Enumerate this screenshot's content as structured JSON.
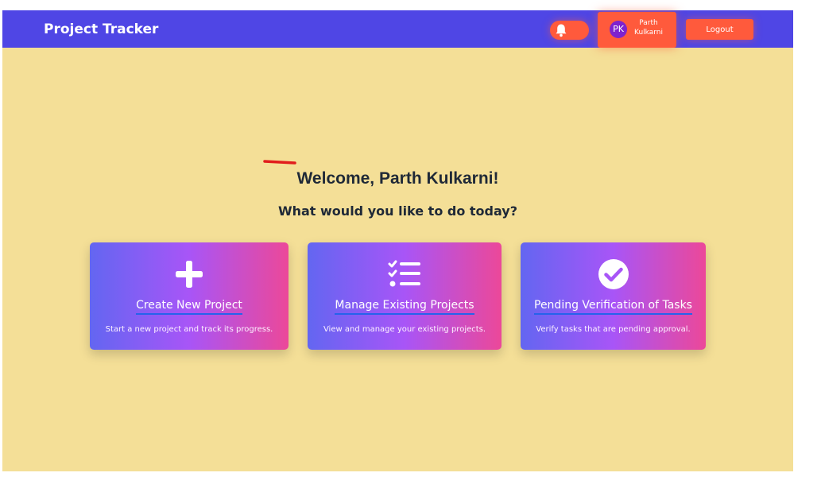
{
  "navbar": {
    "brand": "Project Tracker",
    "bell_icon": "bell-icon",
    "user": {
      "initials": "PK",
      "first_name": "Parth",
      "last_name": "Kulkarni"
    },
    "logout_label": "Logout"
  },
  "main": {
    "welcome": "Welcome, Parth Kulkarni!",
    "subtitle": "What would you like to do today?",
    "cards": [
      {
        "icon": "plus-icon",
        "title": "Create New Project",
        "description": "Start a new project and track its progress."
      },
      {
        "icon": "checklist-icon",
        "title": "Manage Existing Projects",
        "description": "View and manage your existing projects."
      },
      {
        "icon": "check-circle-icon",
        "title": "Pending Verification of Tasks",
        "description": "Verify tasks that are pending approval."
      }
    ]
  },
  "colors": {
    "navbar": "#4f46e5",
    "background": "#f4df97",
    "accent": "#ff5a3c",
    "card_gradient": [
      "#6366f1",
      "#a855f7",
      "#ec4899"
    ],
    "card_title_underline": "#2563eb",
    "annotation_mark": "#e11d1d"
  }
}
